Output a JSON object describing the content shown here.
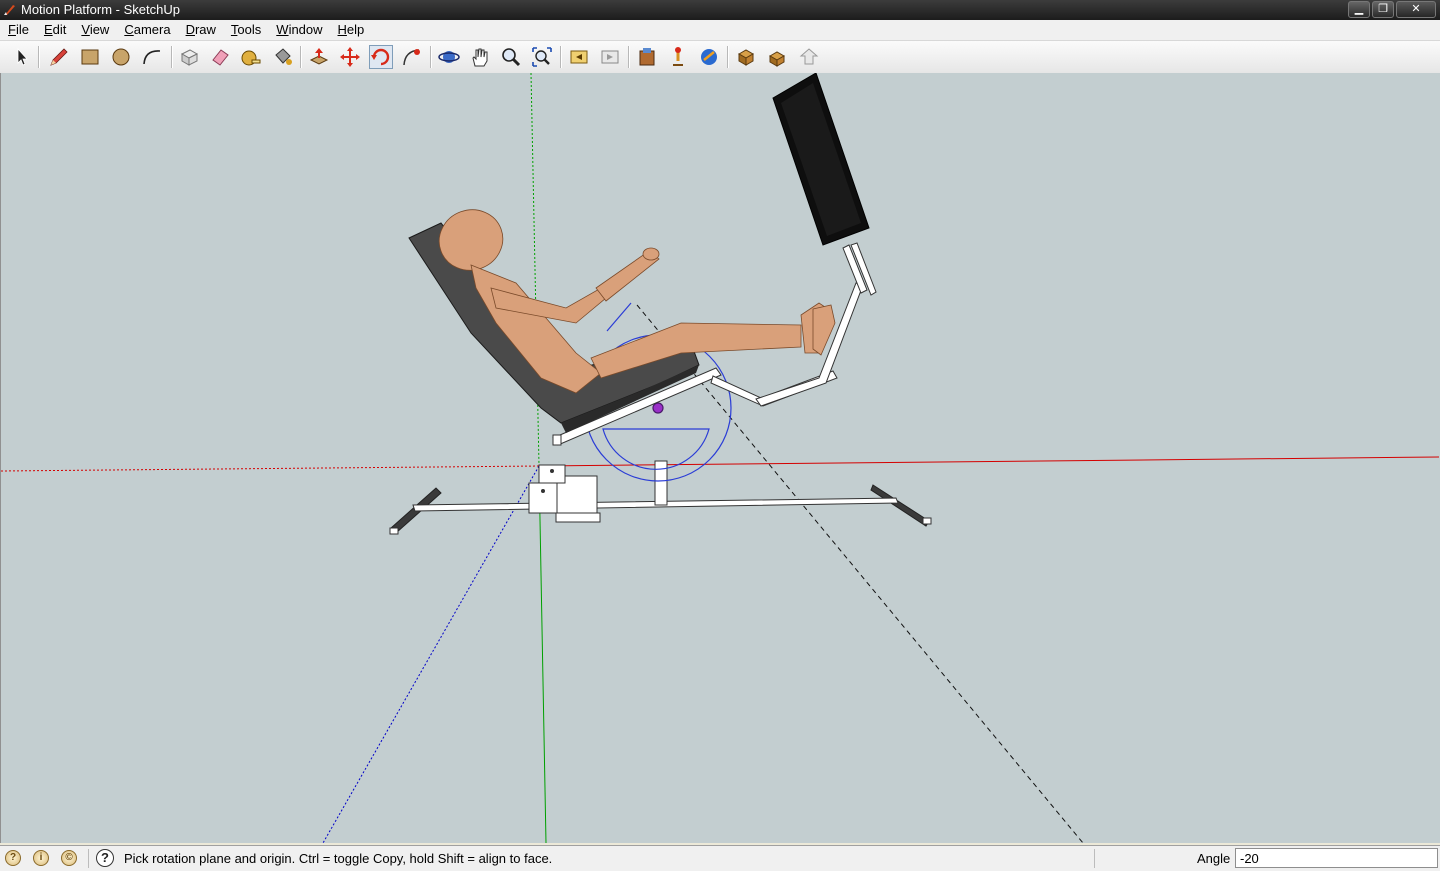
{
  "window": {
    "title": "Motion Platform - SketchUp",
    "buttons": {
      "minimize": "▁",
      "maximize": "❐",
      "close": "✕"
    }
  },
  "menu": [
    {
      "label": "File",
      "accel": "F",
      "rest": "ile"
    },
    {
      "label": "Edit",
      "accel": "E",
      "rest": "dit"
    },
    {
      "label": "View",
      "accel": "V",
      "rest": "iew"
    },
    {
      "label": "Camera",
      "accel": "C",
      "rest": "amera"
    },
    {
      "label": "Draw",
      "accel": "D",
      "rest": "raw"
    },
    {
      "label": "Tools",
      "accel": "T",
      "rest": "ools"
    },
    {
      "label": "Window",
      "accel": "W",
      "rest": "indow"
    },
    {
      "label": "Help",
      "accel": "H",
      "rest": "elp"
    }
  ],
  "toolbar": {
    "tools": [
      "select-tool",
      "pencil-tool",
      "rectangle-tool",
      "circle-tool",
      "arc-tool",
      "make-component-tool",
      "eraser-tool",
      "tape-measure-tool",
      "paint-bucket-tool",
      "push-pull-tool",
      "move-tool",
      "rotate-tool",
      "follow-me-tool",
      "orbit-tool",
      "pan-tool",
      "zoom-tool",
      "zoom-extents-tool",
      "previous-view-tool",
      "next-view-tool",
      "3d-warehouse-tool",
      "share-model-tool",
      "get-models-tool",
      "share-component-tool",
      "google-earth-tool",
      "upload-tool"
    ],
    "active_tool": "rotate-tool"
  },
  "colors": {
    "viewport_bg": "#c3ced0",
    "red_axis": "#d40000",
    "green_axis": "#00a000",
    "blue_axis": "#0000c8",
    "protractor": "#2a3cd6"
  },
  "status": {
    "icons": [
      "geo-location-icon",
      "credits-icon",
      "user-icon"
    ],
    "message": "Pick rotation plane and origin.  Ctrl = toggle Copy, hold Shift = align to face.",
    "vcb_label": "Angle",
    "vcb_value": "-20"
  }
}
